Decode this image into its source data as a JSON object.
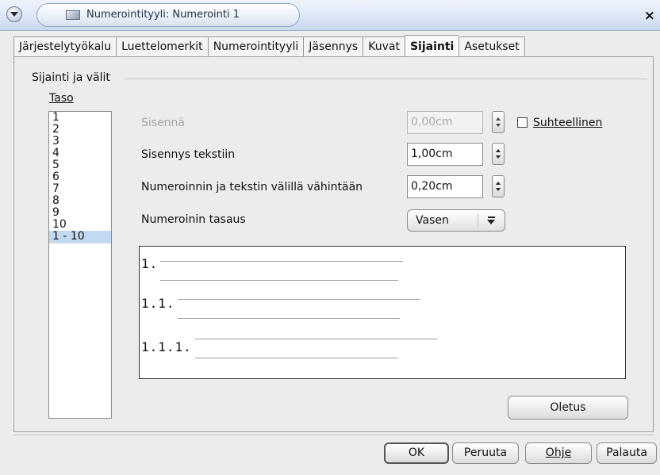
{
  "window": {
    "title": "Numerointityyli: Numerointi 1",
    "close_glyph": "×"
  },
  "tabs": [
    {
      "label": "Järjestelytyökalu",
      "active": false
    },
    {
      "label": "Luettelomerkit",
      "active": false
    },
    {
      "label": "Numerointityyli",
      "active": false
    },
    {
      "label": "Jäsennys",
      "active": false
    },
    {
      "label": "Kuvat",
      "active": false
    },
    {
      "label": "Sijainti",
      "active": true
    },
    {
      "label": "Asetukset",
      "active": false
    }
  ],
  "section": {
    "title": "Sijainti ja välit"
  },
  "level": {
    "label": "Taso",
    "items": [
      "1",
      "2",
      "3",
      "4",
      "5",
      "6",
      "7",
      "8",
      "9",
      "10",
      "1 - 10"
    ],
    "selected": "1 - 10"
  },
  "fields": {
    "indent": {
      "label": "Sisennä",
      "value": "0,00cm",
      "enabled": false
    },
    "relative": {
      "label": "Suhteellinen",
      "checked": false
    },
    "indent_to_text": {
      "label": "Sisennys tekstiin",
      "value": "1,00cm"
    },
    "min_spacing": {
      "label": "Numeroinnin ja tekstin välillä vähintään",
      "value": "0,20cm"
    },
    "alignment": {
      "label": "Numeroinin tasaus",
      "value": "Vasen"
    }
  },
  "preview": {
    "labels": [
      "1.",
      "1.1.",
      "1.1.1."
    ]
  },
  "buttons": {
    "default": "Oletus",
    "ok": "OK",
    "cancel": "Peruuta",
    "help": "Ohje",
    "reset": "Palauta"
  }
}
